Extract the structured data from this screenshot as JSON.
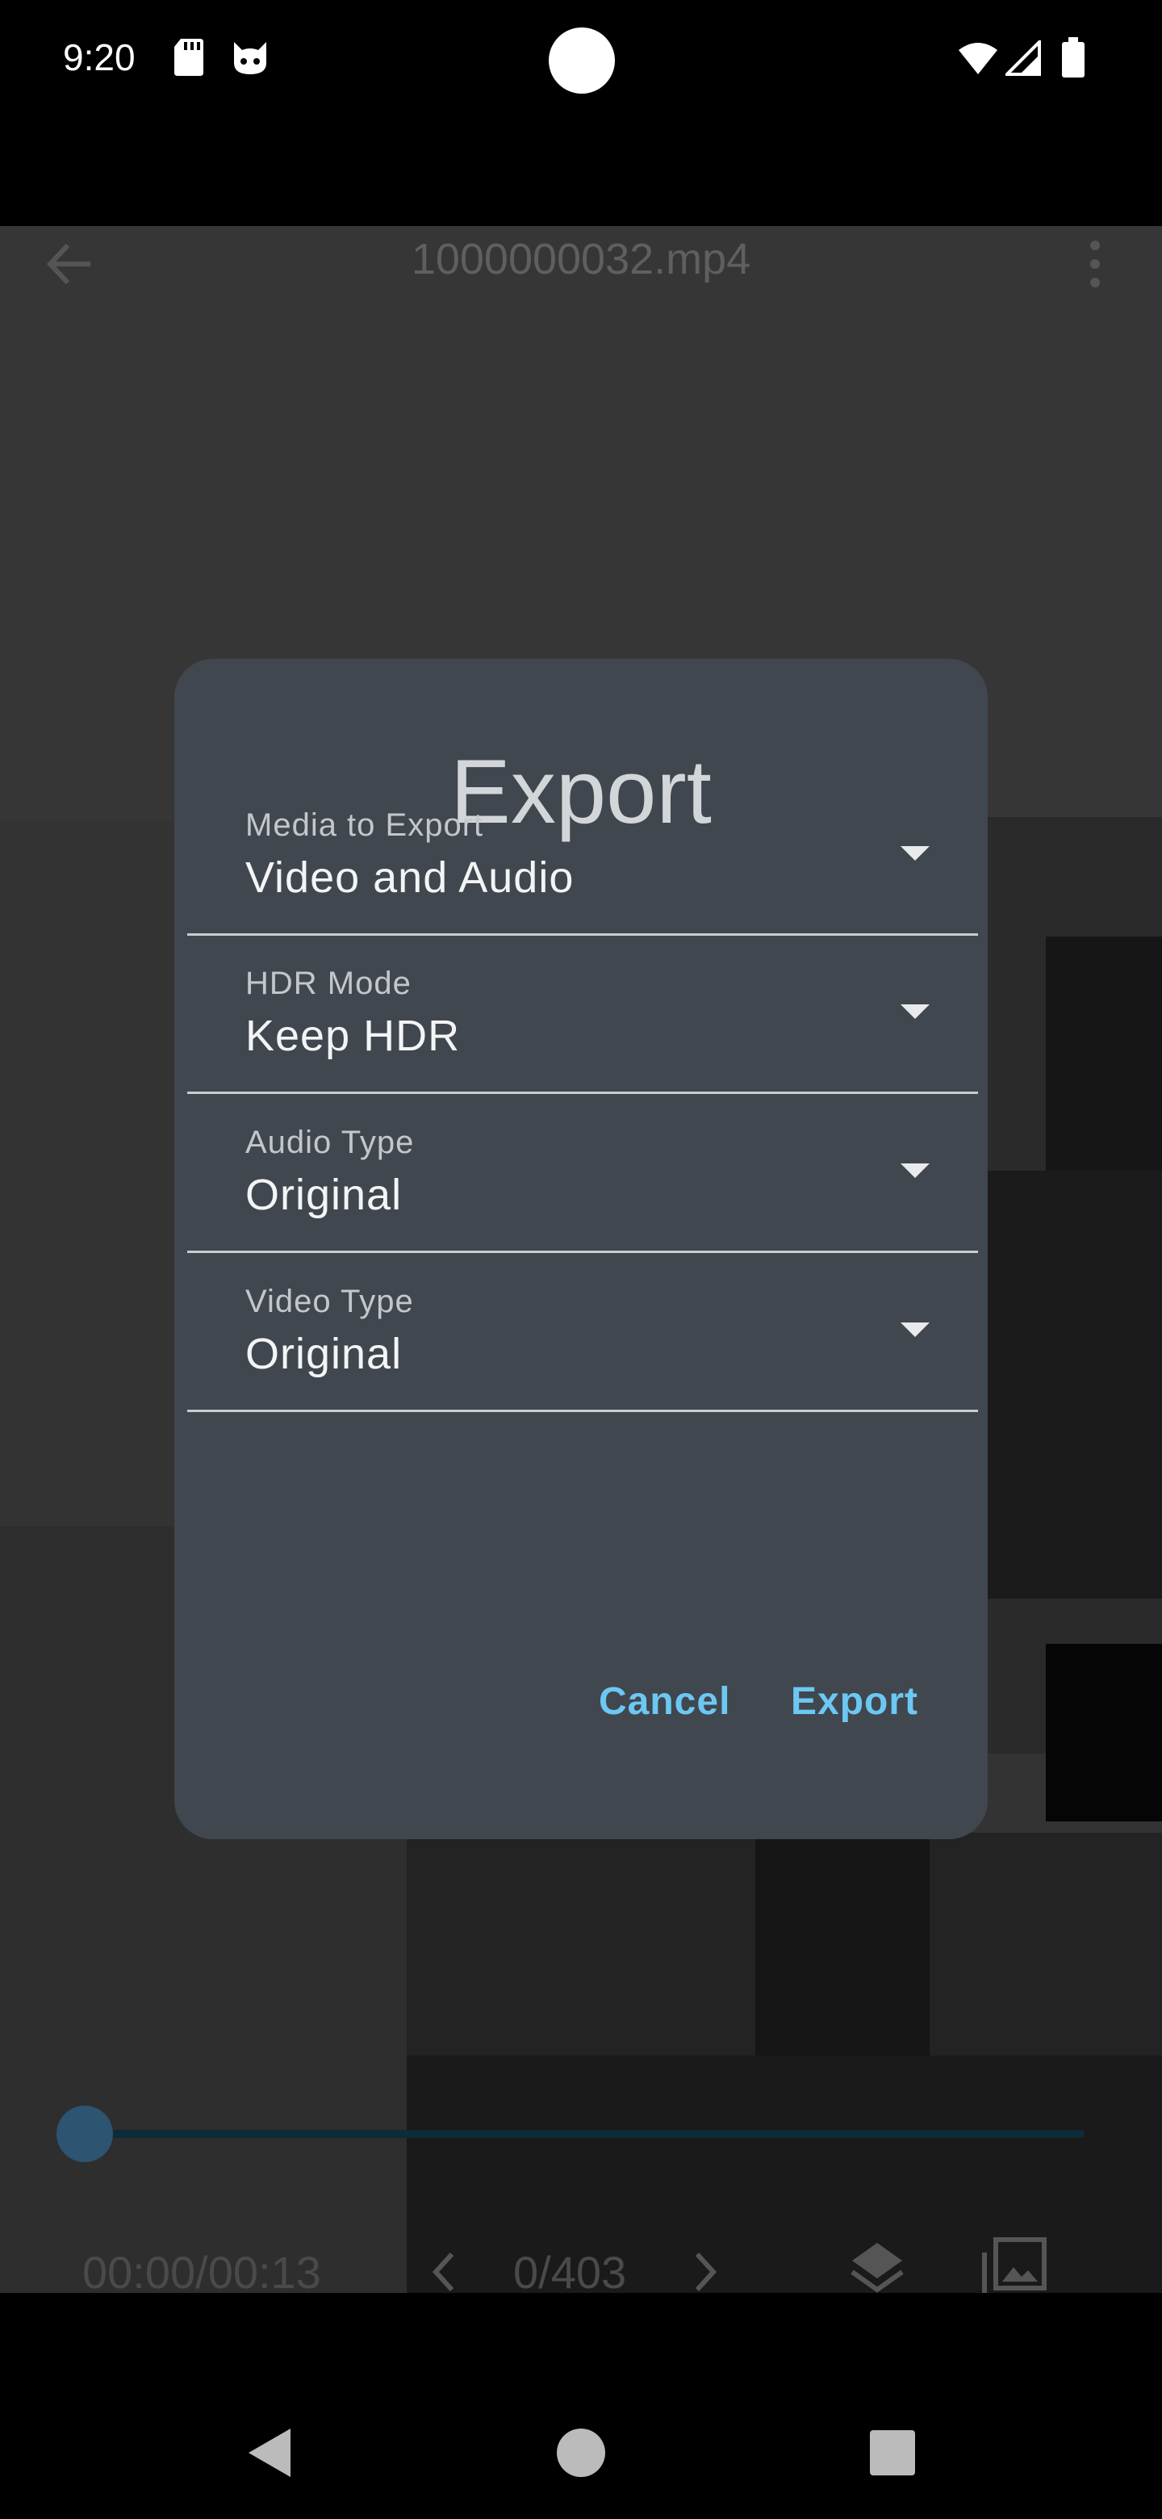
{
  "status_bar": {
    "time": "9:20"
  },
  "top_bar": {
    "title": "1000000032.mp4"
  },
  "dialog": {
    "title": "Export",
    "fields": [
      {
        "label": "Media to Export",
        "value": "Video and Audio"
      },
      {
        "label": "HDR Mode",
        "value": "Keep HDR"
      },
      {
        "label": "Audio Type",
        "value": "Original"
      },
      {
        "label": "Video Type",
        "value": "Original"
      }
    ],
    "cancel_label": "Cancel",
    "export_label": "Export"
  },
  "player": {
    "time_readout": "00:00/00:13",
    "frame_counter": "0/403",
    "progress": 0.0
  },
  "colors": {
    "accent": "#6cc8f3",
    "dialog_bg": "#40474e"
  }
}
